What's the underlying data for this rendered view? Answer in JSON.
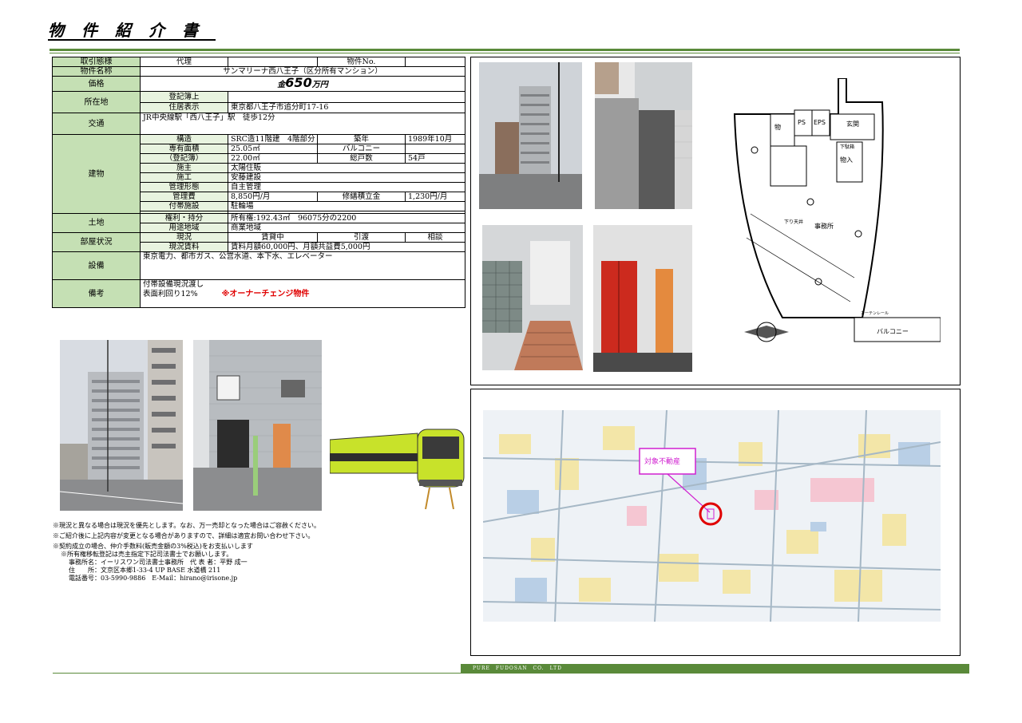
{
  "header": {
    "title": "物件紹介書"
  },
  "spec": {
    "transaction_label": "取引態様",
    "transaction_value": "代理",
    "property_no_label": "物件No.",
    "property_no_value": "",
    "name_label": "物件名称",
    "name_value": "サンマリーナ西八王子（区分所有マンション）",
    "price_label": "価格",
    "price_prefix": "金",
    "price_value": "650",
    "price_unit": "万円",
    "location_label": "所在地",
    "registry_label": "登記簿上",
    "registry_value": "",
    "address_label": "住居表示",
    "address_value": "東京都八王子市追分町17-16",
    "traffic_label": "交通",
    "traffic_value": "JR中央線駅「西八王子」駅　徒歩12分",
    "building_label": "建物",
    "structure_label": "構造",
    "structure_value": "SRC造11階建　4階部分",
    "built_label": "築年",
    "built_value": "1989年10月",
    "area_label": "専有面積",
    "area_value": "25.05㎡",
    "balcony_label": "バルコニー",
    "balcony_value": "",
    "reg_area_label": "（登記簿）",
    "reg_area_value": "22.00㎡",
    "units_label": "総戸数",
    "units_value": "54戸",
    "owner_label": "施主",
    "owner_value": "太陽住販",
    "builder_label": "施工",
    "builder_value": "安藤建設",
    "mgmt_label": "管理形態",
    "mgmt_value": "自主管理",
    "fee_label": "管理費",
    "fee_value": "8,850円/月",
    "repair_label": "修繕積立金",
    "repair_value": "1,230円/月",
    "facility_label": "付帯施設",
    "facility_value": "駐輪場",
    "land_label": "土地",
    "rights_label": "権利・持分",
    "rights_value": "所有権:192.43㎡　96075分の2200",
    "zone_label": "用途地域",
    "zone_value": "商業地域",
    "room_label": "部屋状況",
    "status_label": "現況",
    "status_value": "賃貸中",
    "handover_label": "引渡",
    "handover_value": "相談",
    "rent_label": "現況賃料",
    "rent_value": "賃料月額60,000円、月額共益費5,000円",
    "equip_label": "設備",
    "equip_value": "東京電力、都市ガス、公営水道、本下水、エレベーター",
    "remarks_label": "備考",
    "remarks_line1": "付帯設備現況渡し",
    "remarks_line2": "表面利回り12%",
    "remarks_highlight": "※オーナーチェンジ物件"
  },
  "notes": [
    "※現況と異なる場合は現況を優先とします。なお、万一売却となった場合はご容赦ください。",
    "※ご紹介後に上記内容が変更となる場合がありますので、詳細は適宜お問い合わせ下さい。",
    "※契約成立の場合、仲介手数料(販売金額の3%税込)をお支払いします"
  ],
  "notes2": [
    "※所有権移転登記は売主指定下記司法書士でお願いします。",
    "事務所名：イーリスワン司法書士事務所　代 表 者：平野 成一",
    "住　　所：文京区本郷1-33-4 UP BASE 水道橋 211",
    "電話番号：03-5990-9886　E-Mail：hirano@irisone.jp"
  ],
  "floorplan": {
    "mono": "物",
    "ps": "PS",
    "eps": "EPS",
    "genkan": "玄関",
    "shitabako": "下駄箱",
    "mono_in": "物入",
    "office": "事務所",
    "ceiling": "下り天井",
    "balcony": "バルコニー",
    "curtain": "カーテンレール"
  },
  "map": {
    "target_label": "対象不動産"
  },
  "footer": {
    "company": "PURE　FUDOSAN　CO.　LTD"
  },
  "colors": {
    "accent": "#5a8a3a",
    "label_bg": "#c5e0b4",
    "highlight": "#e00000"
  }
}
